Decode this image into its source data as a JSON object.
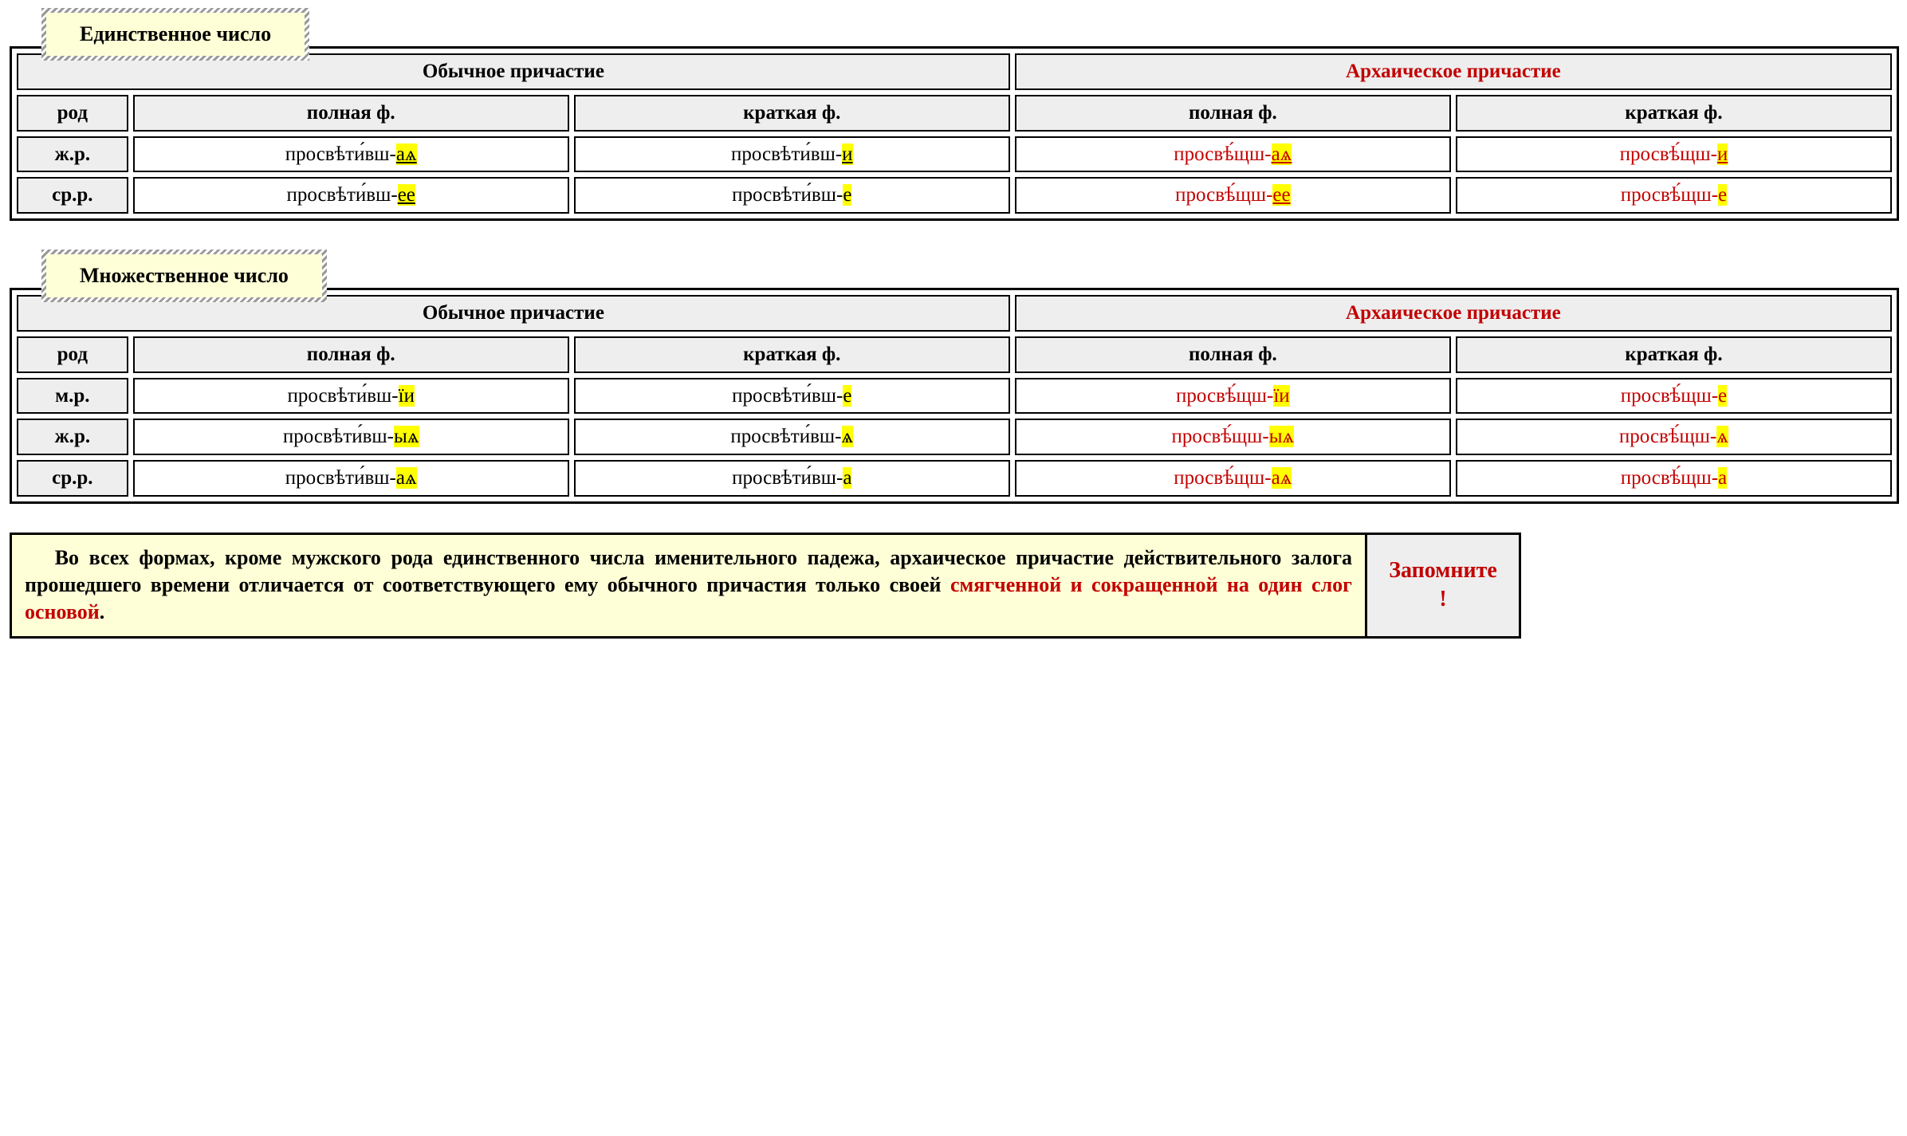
{
  "section1": {
    "title": "Единственное число",
    "col_ordinary": "Обычное причастие",
    "col_archaic": "Архаическое причастие",
    "sub_gender": "род",
    "sub_full": "полная ф.",
    "sub_short": "краткая ф.",
    "rows": [
      {
        "label": "ж.р.",
        "ord_full_stem": "просвѣти́вш-",
        "ord_full_end": "аѧ",
        "ord_short_stem": "просвѣти́вш-",
        "ord_short_end": "и",
        "arc_full_stem": "просвѣ́щш-",
        "arc_full_end": "аѧ",
        "arc_short_stem": "просвѣ́щш-",
        "arc_short_end": "и"
      },
      {
        "label": "ср.р.",
        "ord_full_stem": "просвѣти́вш-",
        "ord_full_end": "ее",
        "ord_short_stem": "просвѣти́вш-",
        "ord_short_end": "е",
        "arc_full_stem": "просвѣ́щш-",
        "arc_full_end": "ее",
        "arc_short_stem": "просвѣ́щш-",
        "arc_short_end": "е"
      }
    ]
  },
  "section2": {
    "title": "Множественное число",
    "col_ordinary": "Обычное причастие",
    "col_archaic": "Архаическое причастие",
    "sub_gender": "род",
    "sub_full": "полная ф.",
    "sub_short": "краткая ф.",
    "rows": [
      {
        "label": "м.р.",
        "ord_full_stem": "просвѣти́вш-",
        "ord_full_end": "їи",
        "ord_short_stem": "просвѣти́вш-",
        "ord_short_end": "е",
        "arc_full_stem": "просвѣ́щш-",
        "arc_full_end": "їи",
        "arc_short_stem": "просвѣ́щш-",
        "arc_short_end": "е"
      },
      {
        "label": "ж.р.",
        "ord_full_stem": "просвѣти́вш-",
        "ord_full_end": "ыѧ",
        "ord_short_stem": "просвѣти́вш-",
        "ord_short_end": "ѧ",
        "arc_full_stem": "просвѣ́щш-",
        "arc_full_end": "ыѧ",
        "arc_short_stem": "просвѣ́щш-",
        "arc_short_end": "ѧ"
      },
      {
        "label": "ср.р.",
        "ord_full_stem": "просвѣти́вш-",
        "ord_full_end": "аѧ",
        "ord_short_stem": "просвѣти́вш-",
        "ord_short_end": "а",
        "arc_full_stem": "просвѣ́щш-",
        "arc_full_end": "аѧ",
        "arc_short_stem": "просвѣ́щш-",
        "arc_short_end": "а"
      }
    ]
  },
  "memo": {
    "text_plain": "Во всех формах, кроме мужского рода единственного числа именительного падежа, архаическое причастие действительного залога прошедшего времени отличается от соответствующего ему обычного причастия только своей ",
    "text_red": "смягченной и сокращенной на один слог основой",
    "period": ".",
    "label": "Запомните",
    "bang": "!"
  }
}
